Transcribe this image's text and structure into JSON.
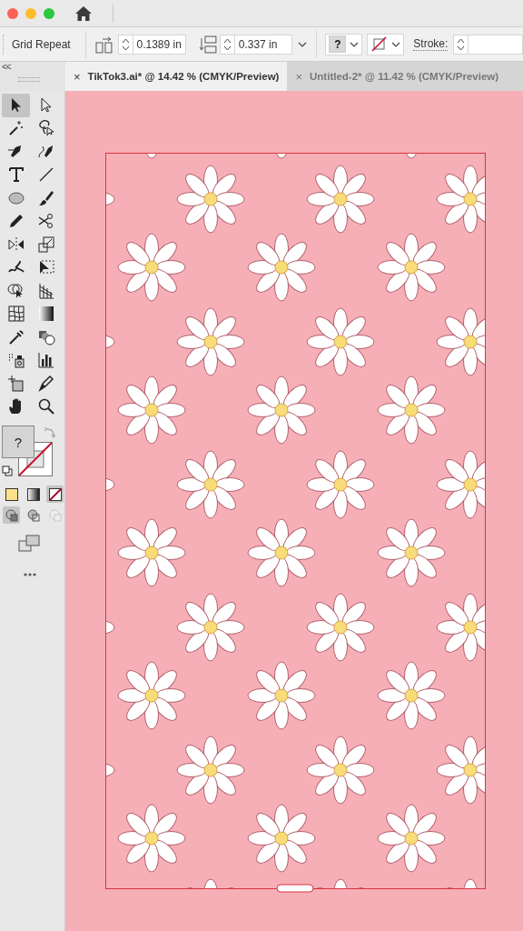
{
  "control_bar": {
    "title": "Grid Repeat",
    "horizontal_spacing": "0.1389 in",
    "vertical_spacing": "0.337 in",
    "fill_swatch": "?",
    "stroke_label": "Stroke:"
  },
  "panel_collapse": "<<",
  "tabs": [
    {
      "close": "×",
      "label": "TikTok3.ai* @ 14.42 % (CMYK/Preview)",
      "selected": true
    },
    {
      "close": "×",
      "label": "Untitled-2* @ 11.42 % (CMYK/Preview)",
      "selected": false
    }
  ],
  "toolbar": {
    "tools": [
      {
        "kind": "selection",
        "selected": true
      },
      {
        "kind": "direct-selection",
        "selected": false
      },
      {
        "kind": "magic-wand",
        "selected": false
      },
      {
        "kind": "lasso",
        "selected": false
      },
      {
        "kind": "pen",
        "selected": false
      },
      {
        "kind": "curvature",
        "selected": false
      },
      {
        "kind": "type",
        "selected": false
      },
      {
        "kind": "line",
        "selected": false
      },
      {
        "kind": "ellipse",
        "selected": false
      },
      {
        "kind": "paintbrush",
        "selected": false
      },
      {
        "kind": "pencil",
        "selected": false
      },
      {
        "kind": "scissors",
        "selected": false
      },
      {
        "kind": "reflect",
        "selected": false
      },
      {
        "kind": "scale",
        "selected": false
      },
      {
        "kind": "warp",
        "selected": false
      },
      {
        "kind": "free-transform",
        "selected": false
      },
      {
        "kind": "shape-builder",
        "selected": false
      },
      {
        "kind": "perspective",
        "selected": false
      },
      {
        "kind": "mesh",
        "selected": false
      },
      {
        "kind": "gradient",
        "selected": false
      },
      {
        "kind": "eyedropper",
        "selected": false
      },
      {
        "kind": "blend",
        "selected": false
      },
      {
        "kind": "symbol-sprayer",
        "selected": false
      },
      {
        "kind": "graph",
        "selected": false
      },
      {
        "kind": "artboard",
        "selected": false
      },
      {
        "kind": "slice",
        "selected": false
      },
      {
        "kind": "hand",
        "selected": false
      },
      {
        "kind": "zoom",
        "selected": false
      }
    ],
    "fill_swatch": "?",
    "color_modes": [
      {
        "kind": "color",
        "selected": false
      },
      {
        "kind": "gradient",
        "selected": false
      },
      {
        "kind": "none",
        "selected": true
      }
    ],
    "draw_modes": [
      {
        "kind": "normal",
        "selected": true,
        "disabled": false
      },
      {
        "kind": "behind",
        "selected": false,
        "disabled": false
      },
      {
        "kind": "inside",
        "selected": false,
        "disabled": true
      }
    ]
  }
}
